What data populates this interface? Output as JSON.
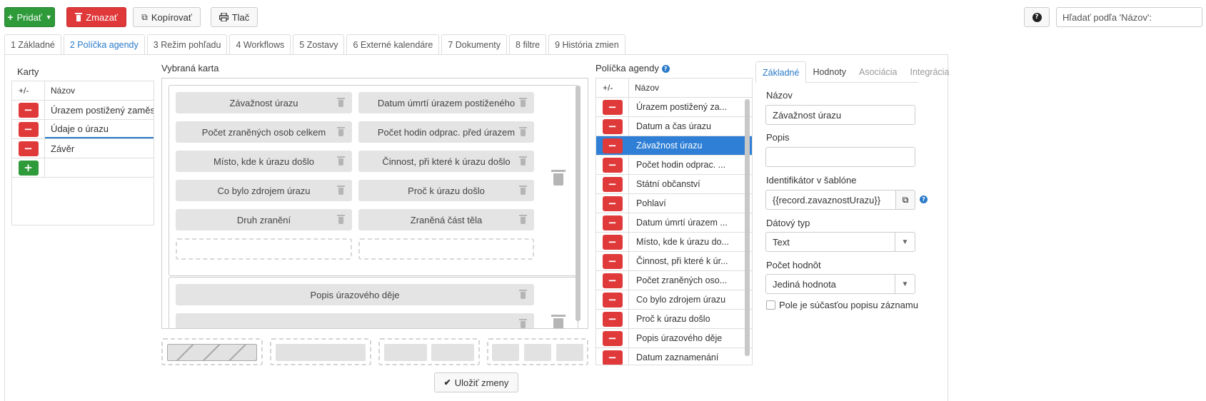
{
  "toolbar": {
    "add_label": "Pridať",
    "delete_label": "Zmazať",
    "copy_label": "Kopírovať",
    "print_label": "Tlač",
    "help_label": "?",
    "search_placeholder": "Hľadať podľa 'Názov':"
  },
  "tabs": [
    {
      "label": "1 Základné"
    },
    {
      "label": "2 Políčka agendy"
    },
    {
      "label": "3 Režim pohľadu"
    },
    {
      "label": "4 Workflows"
    },
    {
      "label": "5 Zostavy"
    },
    {
      "label": "6 Externé kalendáre"
    },
    {
      "label": "7 Dokumenty"
    },
    {
      "label": "8 filtre"
    },
    {
      "label": "9 História zmien"
    }
  ],
  "cards": {
    "title": "Karty",
    "col_action": "+/-",
    "col_name": "Názov",
    "rows": [
      {
        "name": "Úrazem postižený zaměs"
      },
      {
        "name": "Údaje o úrazu"
      },
      {
        "name": "Závěr"
      }
    ]
  },
  "selected_card": {
    "title": "Vybraná karta",
    "section1": [
      {
        "label": "Závažnost úrazu"
      },
      {
        "label": "Datum úmrtí úrazem postiženého"
      },
      {
        "label": "Počet zraněných osob celkem"
      },
      {
        "label": "Počet hodin odprac. před úrazem"
      },
      {
        "label": "Místo, kde k úrazu došlo"
      },
      {
        "label": "Činnost, při které k úrazu došlo"
      },
      {
        "label": "Co bylo zdrojem úrazu"
      },
      {
        "label": "Proč k úrazu došlo"
      },
      {
        "label": "Druh zranění"
      },
      {
        "label": "Zraněná část těla"
      }
    ],
    "section2": [
      {
        "label": "Popis úrazového děje"
      }
    ],
    "save_label": "Uložiť zmeny"
  },
  "agenda_fields": {
    "title": "Políčka agendy",
    "col_action": "+/-",
    "col_name": "Názov",
    "rows": [
      {
        "name": "Úrazem postižený za..."
      },
      {
        "name": "Datum a čas úrazu"
      },
      {
        "name": "Závažnost úrazu"
      },
      {
        "name": "Počet hodin odprac. ..."
      },
      {
        "name": "Státní občanství"
      },
      {
        "name": "Pohlaví"
      },
      {
        "name": "Datum úmrtí úrazem ..."
      },
      {
        "name": "Místo, kde k úrazu do..."
      },
      {
        "name": "Činnost, při které k úr..."
      },
      {
        "name": "Počet zraněných oso..."
      },
      {
        "name": "Co bylo zdrojem úrazu"
      },
      {
        "name": "Proč k úrazu došlo"
      },
      {
        "name": "Popis úrazového děje"
      },
      {
        "name": "Datum zaznamenání"
      }
    ]
  },
  "detail": {
    "tabs": [
      {
        "label": "Základné"
      },
      {
        "label": "Hodnoty"
      },
      {
        "label": "Asociácia"
      },
      {
        "label": "Integrácia"
      }
    ],
    "name_label": "Názov",
    "name_value": "Závažnost úrazu",
    "desc_label": "Popis",
    "desc_value": "",
    "id_label": "Identifikátor v šablóne",
    "id_value": "{{record.zavaznostUrazu}}",
    "type_label": "Dátový typ",
    "type_value": "Text",
    "count_label": "Počet hodnôt",
    "count_value": "Jediná hodnota",
    "checkbox_label": "Pole je súčasťou popisu záznamu"
  },
  "colors": {
    "accent": "#2a7ac8",
    "green": "#2e9a3a",
    "red": "#e0393a",
    "selected_row": "#2f7fd6"
  }
}
